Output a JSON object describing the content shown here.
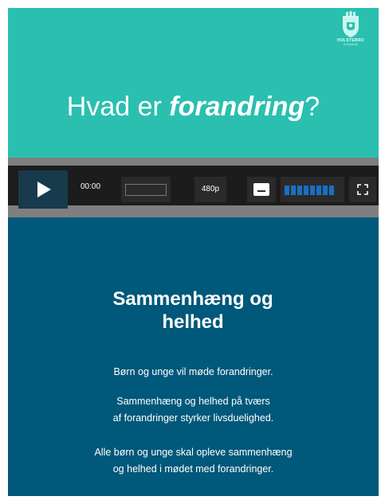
{
  "hero": {
    "title_prefix": "Hvad er ",
    "title_emphasis": "forandring",
    "title_suffix": "?",
    "background": "#2bbfb0",
    "logo": {
      "icon": "holstebro-crest-icon",
      "name": "HOLSTEBRO",
      "subtitle": "KOMMUNE"
    }
  },
  "player": {
    "play_icon": "play-icon",
    "time": "00:00",
    "progress": 0,
    "quality": "480p",
    "captions_icon": "captions-icon",
    "volume_level": 1.0,
    "volume_segments": 8,
    "fullscreen_icon": "fullscreen-icon",
    "accent": "#1a6fc4"
  },
  "info": {
    "background": "#00587a",
    "heading_line1": "Sammenhæng og",
    "heading_line2": "helhed",
    "paragraph1": "Børn og unge vil møde forandringer.",
    "paragraph2_line1": "Sammenhæng og helhed på tværs",
    "paragraph2_line2": "af forandringer styrker livsduelighed.",
    "paragraph3_line1": "Alle børn og unge skal opleve sammenhæng",
    "paragraph3_line2": "og helhed i mødet med forandringer."
  }
}
